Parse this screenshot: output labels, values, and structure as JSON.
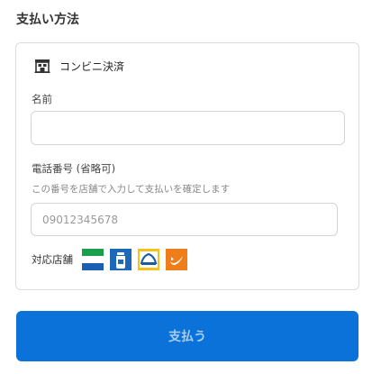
{
  "section_title": "支払い方法",
  "method": {
    "label": "コンビニ決済",
    "icon": "convenience-store-icon"
  },
  "name_field": {
    "label": "名前",
    "value": "",
    "placeholder": ""
  },
  "phone_field": {
    "label": "電話番号 (省略可)",
    "hint": "この番号を店舗で入力して支払いを確定します",
    "value": "",
    "placeholder": "09012345678"
  },
  "stores": {
    "label": "対応店舗",
    "logos": [
      "familymart-logo",
      "lawson-logo",
      "ministop-logo",
      "seicomart-logo"
    ]
  },
  "pay_button": {
    "label": "支払う"
  },
  "colors": {
    "accent": "#0a72d8",
    "button_text": "#a9ccef",
    "border": "#dcdcdc"
  }
}
